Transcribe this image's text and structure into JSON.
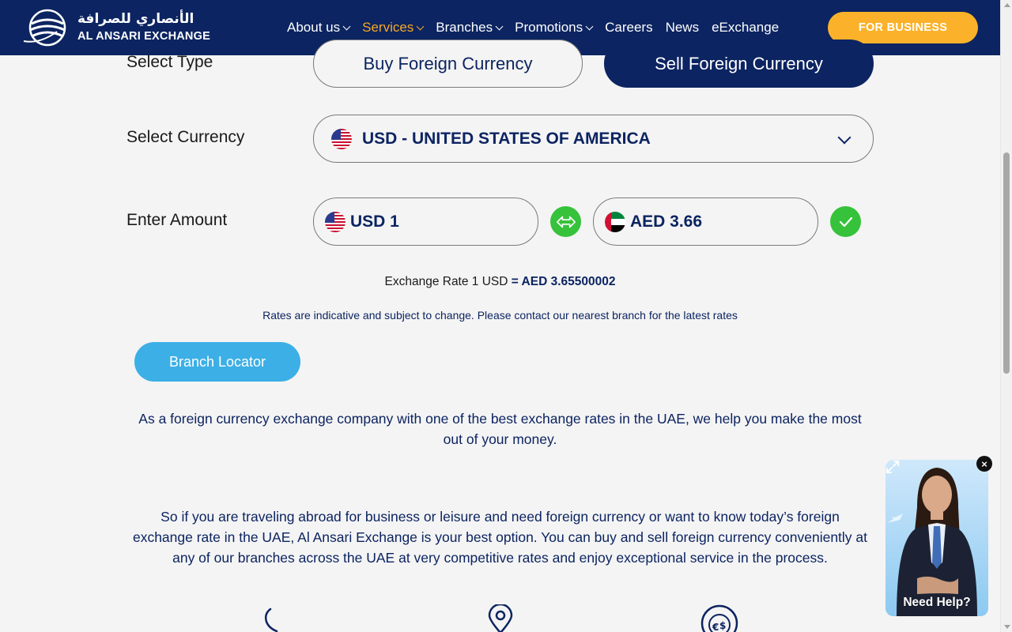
{
  "header": {
    "logo_arabic": "الأنصاري للصرافة",
    "logo_english": "AL ANSARI EXCHANGE",
    "nav": [
      {
        "label": "About us",
        "dropdown": true,
        "active": false
      },
      {
        "label": "Services",
        "dropdown": true,
        "active": true
      },
      {
        "label": "Branches",
        "dropdown": true,
        "active": false
      },
      {
        "label": "Promotions",
        "dropdown": true,
        "active": false
      },
      {
        "label": "Careers",
        "dropdown": false,
        "active": false
      },
      {
        "label": "News",
        "dropdown": false,
        "active": false
      },
      {
        "label": "eExchange",
        "dropdown": false,
        "active": false
      }
    ],
    "business_button": "FOR BUSINESS"
  },
  "form": {
    "select_type_label": "Select Type",
    "buy_label": "Buy Foreign Currency",
    "sell_label": "Sell Foreign Currency",
    "selected_type": "sell",
    "select_currency_label": "Select Currency",
    "currency_value": "USD - UNITED STATES OF AMERICA",
    "enter_amount_label": "Enter Amount",
    "from_amount": "USD 1",
    "to_amount": "AED 3.66",
    "rate_prefix": "Exchange Rate 1 USD",
    "rate_value": "= AED 3.65500002",
    "disclaimer": "Rates are indicative and subject to change. Please contact our nearest branch for the latest rates"
  },
  "branch_locator": "Branch Locator",
  "paragraphs": {
    "p1": "As a foreign currency exchange company with one of the best exchange rates in the UAE, we help you make the most out of your money.",
    "p2": "So if you are traveling abroad for business or leisure and need foreign currency or want to know today’s foreign exchange rate in the UAE, Al Ansari Exchange is your best option. You can buy and sell foreign currency conveniently at any of our branches across the UAE at very competitive rates and enjoy exceptional service in the process."
  },
  "help_widget": {
    "label": "Need Help?",
    "close": "×"
  },
  "icons": {
    "bottom": [
      "phone-icon",
      "location-pin-icon",
      "currency-exchange-icon"
    ]
  },
  "colors": {
    "navy": "#0c2461",
    "accent_orange": "#f7a823",
    "business_yellow": "#fbb22a",
    "green": "#36c23a",
    "sky_blue": "#3cafe6"
  }
}
